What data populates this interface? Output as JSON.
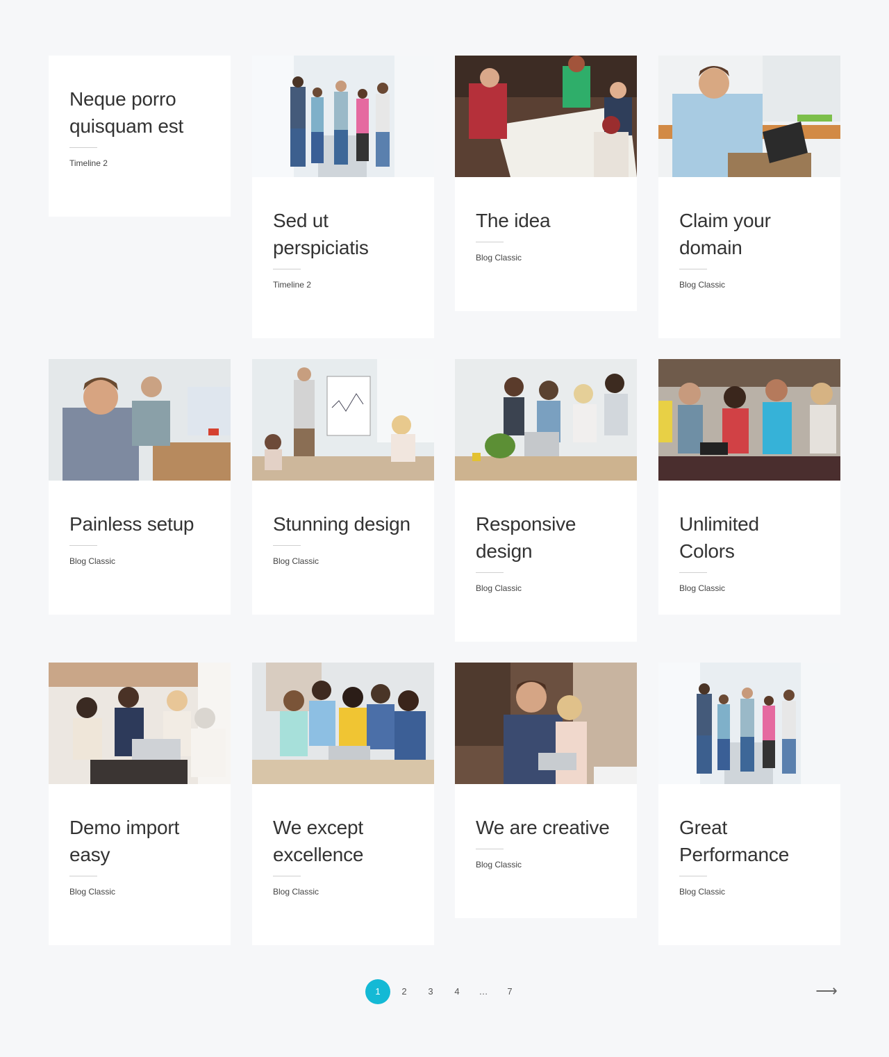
{
  "accent_color": "#14b9d5",
  "cards": [
    {
      "title": "Neque porro quisquam est",
      "category": "Timeline 2",
      "image": "none"
    },
    {
      "title": "Sed ut perspiciatis",
      "category": "Timeline 2",
      "image": "group-jumping-hallway-photo"
    },
    {
      "title": "The idea",
      "category": "Blog Classic",
      "image": "team-whiteboard-sketch-photo"
    },
    {
      "title": "Claim your domain",
      "category": "Blog Classic",
      "image": "man-on-phone-clipboard-photo"
    },
    {
      "title": "Painless setup",
      "category": "Blog Classic",
      "image": "smiling-man-office-photo"
    },
    {
      "title": "Stunning design",
      "category": "Blog Classic",
      "image": "presentation-flipchart-photo"
    },
    {
      "title": "Responsive design",
      "category": "Blog Classic",
      "image": "team-at-laptop-photo"
    },
    {
      "title": "Unlimited Colors",
      "category": "Blog Classic",
      "image": "friends-with-tablet-photo"
    },
    {
      "title": "Demo import easy",
      "category": "Blog Classic",
      "image": "business-meeting-cafe-photo"
    },
    {
      "title": "We except excellence",
      "category": "Blog Classic",
      "image": "team-around-laptop-photo"
    },
    {
      "title": "We are creative",
      "category": "Blog Classic",
      "image": "couple-with-tablet-photo"
    },
    {
      "title": "Great Performance",
      "category": "Blog Classic",
      "image": "group-jumping-hallway-photo"
    }
  ],
  "pagination": {
    "pages": [
      "1",
      "2",
      "3",
      "4",
      "…",
      "7"
    ],
    "current": "1",
    "next_icon": "arrow-right-icon",
    "next_glyph": "⟶"
  }
}
